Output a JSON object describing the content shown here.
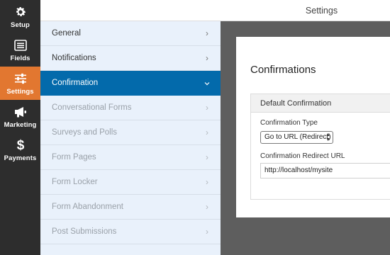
{
  "rail": {
    "items": [
      {
        "label": "Setup",
        "icon": "gear-icon"
      },
      {
        "label": "Fields",
        "icon": "fields-icon"
      },
      {
        "label": "Settings",
        "icon": "sliders-icon",
        "active": true
      },
      {
        "label": "Marketing",
        "icon": "megaphone-icon"
      },
      {
        "label": "Payments",
        "icon": "dollar-icon"
      }
    ]
  },
  "topbar": {
    "title": "Settings"
  },
  "menu": {
    "items": [
      {
        "label": "General",
        "state": "normal"
      },
      {
        "label": "Notifications",
        "state": "normal"
      },
      {
        "label": "Confirmation",
        "state": "active"
      },
      {
        "label": "Conversational Forms",
        "state": "disabled"
      },
      {
        "label": "Surveys and Polls",
        "state": "disabled"
      },
      {
        "label": "Form Pages",
        "state": "disabled"
      },
      {
        "label": "Form Locker",
        "state": "disabled"
      },
      {
        "label": "Form Abandonment",
        "state": "disabled"
      },
      {
        "label": "Post Submissions",
        "state": "disabled"
      }
    ]
  },
  "panel": {
    "title": "Confirmations",
    "section_title": "Default Confirmation",
    "type_label": "Confirmation Type",
    "type_value": "Go to URL (Redirect)",
    "url_label": "Confirmation Redirect URL",
    "url_value": "http://localhost/mysite"
  },
  "colors": {
    "accent": "#e27730",
    "active_menu": "#036aab",
    "rail_bg": "#2d2d2d",
    "menu_bg": "#e9f1fb"
  }
}
